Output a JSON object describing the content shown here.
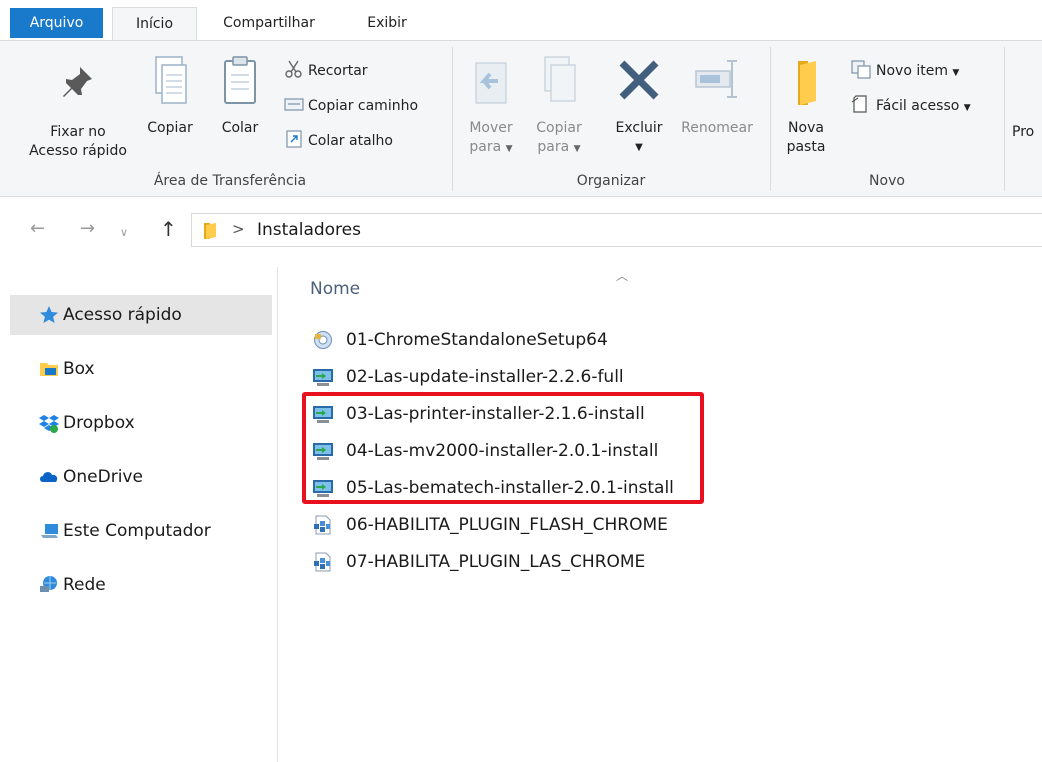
{
  "ribbon": {
    "tabs": [
      "Arquivo",
      "Início",
      "Compartilhar",
      "Exibir"
    ],
    "clipboard": {
      "pin": [
        "Fixar no",
        "Acesso rápido"
      ],
      "copy": "Copiar",
      "paste": "Colar",
      "cut": "Recortar",
      "copy_path": "Copiar caminho",
      "paste_shortcut": "Colar atalho",
      "label": "Área de Transferência"
    },
    "organize": {
      "move_to": [
        "Mover",
        "para"
      ],
      "copy_to": [
        "Copiar",
        "para"
      ],
      "delete": "Excluir",
      "rename": "Renomear",
      "label": "Organizar"
    },
    "new": {
      "new_folder": [
        "Nova",
        "pasta"
      ],
      "new_item": "Novo item",
      "easy_access": "Fácil acesso",
      "label": "Novo"
    },
    "overflow": "Pro"
  },
  "address": {
    "path": "Instaladores"
  },
  "navpane": {
    "items": [
      {
        "label": "Acesso rápido",
        "icon": "star-icon",
        "selected": true
      },
      {
        "label": "Box",
        "icon": "box-folder-icon"
      },
      {
        "label": "Dropbox",
        "icon": "dropbox-icon"
      },
      {
        "label": "OneDrive",
        "icon": "onedrive-icon"
      },
      {
        "label": "Este Computador",
        "icon": "computer-icon"
      },
      {
        "label": "Rede",
        "icon": "network-icon"
      }
    ]
  },
  "filelist": {
    "column_name": "Nome",
    "files": [
      {
        "name": "01-ChromeStandaloneSetup64",
        "icon": "installer-disc-icon"
      },
      {
        "name": "02-Las-update-installer-2.2.6-full",
        "icon": "installer-monitor-icon"
      },
      {
        "name": "03-Las-printer-installer-2.1.6-install",
        "icon": "installer-monitor-icon"
      },
      {
        "name": "04-Las-mv2000-installer-2.0.1-install",
        "icon": "installer-monitor-icon"
      },
      {
        "name": "05-Las-bematech-installer-2.0.1-install",
        "icon": "installer-monitor-icon"
      },
      {
        "name": "06-HABILITA_PLUGIN_FLASH_CHROME",
        "icon": "registry-file-icon"
      },
      {
        "name": "07-HABILITA_PLUGIN_LAS_CHROME",
        "icon": "registry-file-icon"
      }
    ]
  },
  "colors": {
    "accent": "#1979ca",
    "highlight": "#e8101e"
  }
}
